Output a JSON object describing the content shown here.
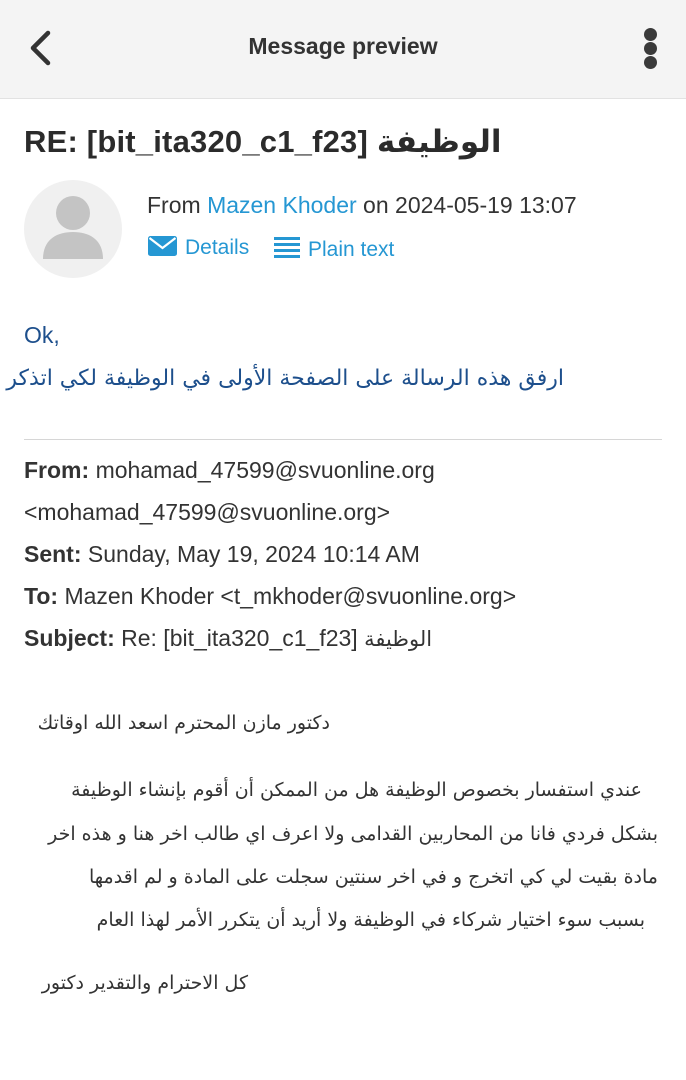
{
  "header": {
    "title": "Message preview",
    "back_icon": "chevron-left-icon",
    "menu_icon": "more-vertical-icon"
  },
  "message": {
    "subject_prefix": "RE: [bit_ita320_c1_f23]",
    "subject_arabic": "الوظيفة",
    "from_prefix": "From",
    "sender_name": "Mazen Khoder",
    "on_label": "on",
    "date": "2024-05-19 13:07",
    "details_label": "Details",
    "plain_text_label": "Plain text"
  },
  "body": {
    "line1": "Ok,",
    "line2": "ارفق هذه الرسالة على الصفحة الأولى في الوظيفة لكي اتذكر"
  },
  "quoted": {
    "from_label": "From:",
    "from_value": "mohamad_47599@svuonline.org",
    "from_value2": "<mohamad_47599@svuonline.org>",
    "sent_label": "Sent:",
    "sent_value": "Sunday, May 19, 2024 10:14 AM",
    "to_label": "To:",
    "to_value": "Mazen Khoder <t_mkhoder@svuonline.org>",
    "subject_label": "Subject:",
    "subject_value": "Re: [bit_ita320_c1_f23]",
    "subject_arabic": "الوظيفة",
    "greeting": "دكتور مازن المحترم اسعد الله اوقاتك",
    "para_lines": [
      "عندي استفسار بخصوص الوظيفة هل من الممكن أن أقوم بإنشاء الوظيفة",
      "بشكل فردي فانا من المحاربين القدامى ولا اعرف اي طالب اخر هنا و هذه اخر",
      "مادة بقيت لي كي اتخرج و في اخر سنتين سجلت على المادة و لم اقدمها",
      "بسبب سوء اختيار شركاء في الوظيفة ولا أريد أن يتكرر الأمر لهذا العام"
    ],
    "closing": "كل الاحترام والتقدير دكتور"
  },
  "colors": {
    "accent": "#2597d3",
    "body_text": "#1d4f8c",
    "topbar_bg": "#f4f4f4"
  }
}
